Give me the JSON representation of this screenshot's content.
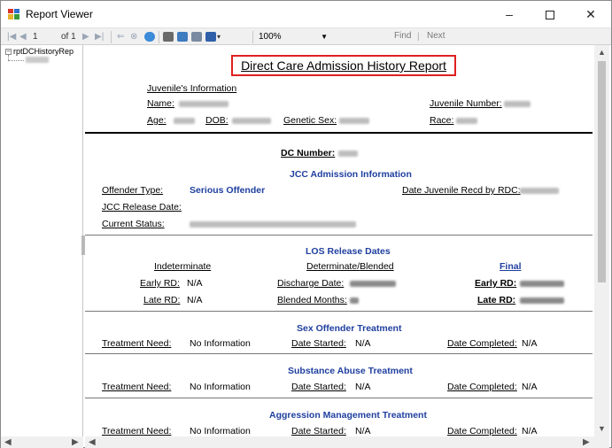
{
  "window": {
    "title": "Report Viewer",
    "minimize": "–",
    "maximize": "",
    "close": "✕"
  },
  "toolbar": {
    "page_current": "1",
    "page_of": "of 1",
    "zoom": "100%",
    "find": "Find",
    "divider": "|",
    "next": "Next"
  },
  "docmap": {
    "root": "rptDCHistoryRep",
    "expander": "−"
  },
  "report": {
    "title": "Direct Care Admission History Report",
    "juvenile_info_label": "Juvenile's Information",
    "name_label": "Name:",
    "juvenile_number_label": "Juvenile Number:",
    "age_label": "Age:",
    "dob_label": "DOB:",
    "genetic_sex_label": "Genetic Sex:",
    "race_label": "Race:",
    "dc_number_label": "DC Number:",
    "jcc_section": "JCC Admission Information",
    "offender_type_label": "Offender Type:",
    "offender_type_value": "Serious Offender",
    "date_recd_label": "Date Juvenile Recd by RDC:",
    "jcc_release_label": "JCC Release Date:",
    "current_status_label": "Current Status:",
    "los_section": "LOS Release Dates",
    "indeterminate": "Indeterminate",
    "determinate": "Determinate/Blended",
    "final": "Final",
    "early_rd_label": "Early RD:",
    "early_rd_value": "N/A",
    "late_rd_label": "Late RD:",
    "late_rd_value": "N/A",
    "discharge_label": "Discharge Date:",
    "blended_label": "Blended Months:",
    "final_early_label": "Early RD:",
    "final_late_label": "Late RD:",
    "sections": [
      {
        "heading": "Sex Offender Treatment",
        "need_label": "Treatment Need:",
        "need_value": "No Information",
        "started_label": "Date Started:",
        "started_value": "N/A",
        "completed_label": "Date Completed:",
        "completed_value": "N/A"
      },
      {
        "heading": "Substance Abuse Treatment",
        "need_label": "Treatment Need:",
        "need_value": "No Information",
        "started_label": "Date Started:",
        "started_value": "N/A",
        "completed_label": "Date Completed:",
        "completed_value": "N/A"
      },
      {
        "heading": "Aggression Management Treatment",
        "need_label": "Treatment Need:",
        "need_value": "No Information",
        "started_label": "Date Started:",
        "started_value": "N/A",
        "completed_label": "Date Completed:",
        "completed_value": "N/A"
      }
    ]
  },
  "colors": {
    "heading_blue": "#1f3f9f",
    "title_border": "#e02020"
  }
}
